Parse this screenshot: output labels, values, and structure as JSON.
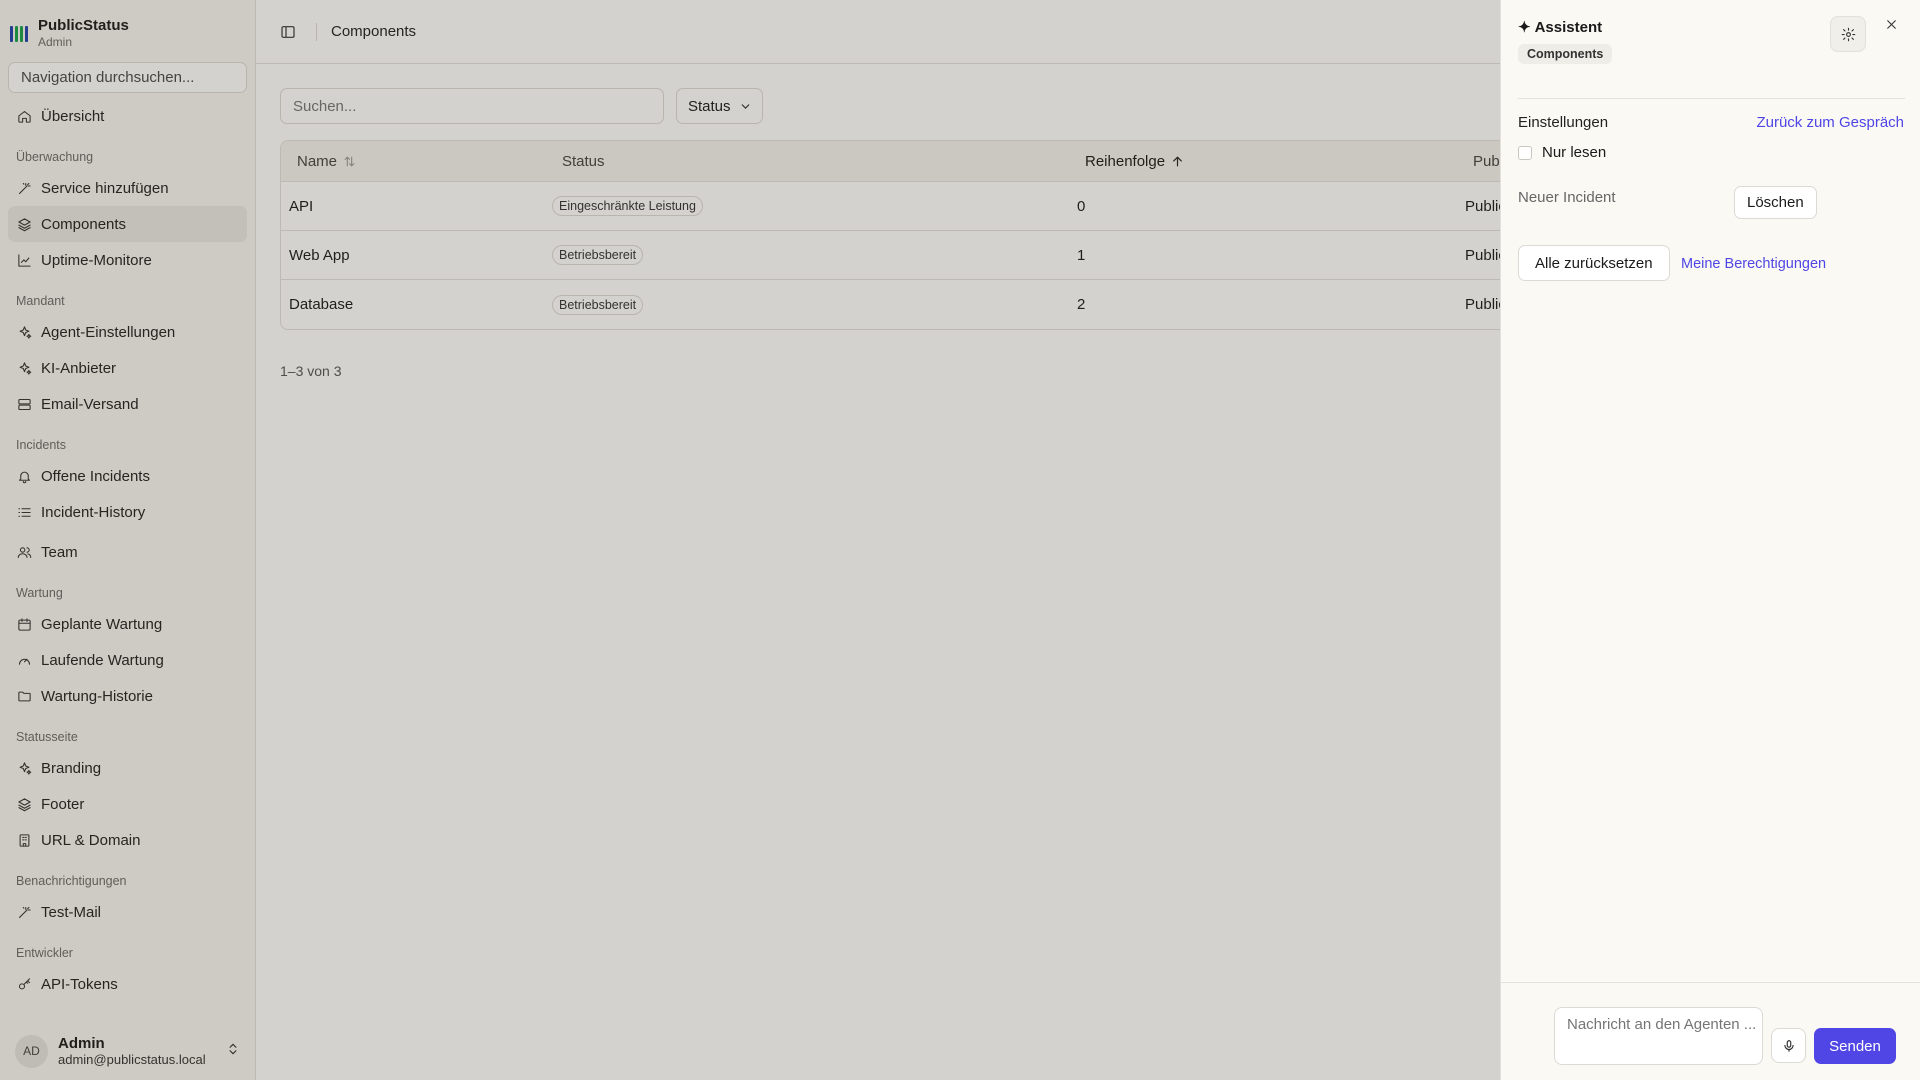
{
  "app": {
    "name": "PublicStatus",
    "role": "Admin"
  },
  "sidebar": {
    "search_placeholder": "Navigation durchsuchen...",
    "top_item": {
      "label": "Übersicht",
      "icon": "home-icon"
    },
    "groups": [
      {
        "title": "Überwachung",
        "items": [
          {
            "label": "Service hinzufügen",
            "icon": "wand-icon"
          },
          {
            "label": "Components",
            "icon": "layers-icon",
            "active": true
          },
          {
            "label": "Uptime-Monitore",
            "icon": "chart-line-icon"
          }
        ]
      },
      {
        "title": "Mandant",
        "items": [
          {
            "label": "Agent-Einstellungen",
            "icon": "sparkles-icon"
          },
          {
            "label": "KI-Anbieter",
            "icon": "sparkles-icon"
          },
          {
            "label": "Email-Versand",
            "icon": "server-icon"
          }
        ]
      },
      {
        "title": "Incidents",
        "items": [
          {
            "label": "Offene Incidents",
            "icon": "bell-icon"
          },
          {
            "label": "Incident-History",
            "icon": "list-icon"
          }
        ]
      },
      {
        "title": "",
        "items": [
          {
            "label": "Team",
            "icon": "users-icon"
          }
        ]
      },
      {
        "title": "Wartung",
        "items": [
          {
            "label": "Geplante Wartung",
            "icon": "calendar-icon"
          },
          {
            "label": "Laufende Wartung",
            "icon": "gauge-icon"
          },
          {
            "label": "Wartung-Historie",
            "icon": "folder-icon"
          }
        ]
      },
      {
        "title": "Statusseite",
        "items": [
          {
            "label": "Branding",
            "icon": "sparkles-icon"
          },
          {
            "label": "Footer",
            "icon": "layers-icon"
          },
          {
            "label": "URL & Domain",
            "icon": "building-icon"
          }
        ]
      },
      {
        "title": "Benachrichtigungen",
        "items": [
          {
            "label": "Test-Mail",
            "icon": "wand-icon"
          }
        ]
      },
      {
        "title": "Entwickler",
        "items": [
          {
            "label": "API-Tokens",
            "icon": "key-icon"
          }
        ]
      }
    ],
    "user": {
      "initials": "AD",
      "name": "Admin",
      "email": "admin@publicstatus.local"
    }
  },
  "header": {
    "breadcrumb": "Components"
  },
  "toolbar": {
    "search_placeholder": "Suchen...",
    "status_filter": "Status"
  },
  "table": {
    "columns": [
      "Name",
      "Status",
      "Reihenfolge",
      "Pub"
    ],
    "rows": [
      {
        "name": "API",
        "status": "Eingeschränkte Leistung",
        "order": "0",
        "pub": "Public"
      },
      {
        "name": "Web App",
        "status": "Betriebsbereit",
        "order": "1",
        "pub": "Public"
      },
      {
        "name": "Database",
        "status": "Betriebsbereit",
        "order": "2",
        "pub": "Public"
      }
    ],
    "pagination": "1–3 von 3"
  },
  "assistant": {
    "title": "Assistent",
    "context_badge": "Components",
    "settings_title": "Einstellungen",
    "back_link": "Zurück zum Gespräch",
    "readonly_label": "Nur lesen",
    "new_incident_label": "Neuer Incident",
    "delete_label": "Löschen",
    "reset_label": "Alle zurücksetzen",
    "permissions_link": "Meine Berechtigungen",
    "message_placeholder": "Nachricht an den Agenten ...",
    "send_label": "Senden"
  },
  "colors": {
    "accent": "#4f46e5",
    "logo": [
      "#1e40af",
      "#16a34a",
      "#16a34a",
      "#1e40af"
    ]
  }
}
